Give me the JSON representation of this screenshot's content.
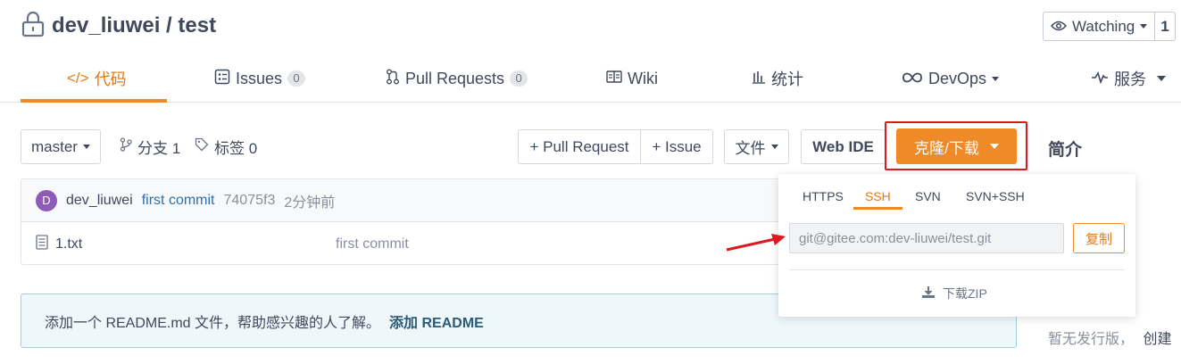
{
  "header": {
    "repo_path": "dev_liuwei / test",
    "watch_label": "Watching",
    "watch_count": "1"
  },
  "tabs": [
    {
      "label": "代码",
      "icon": "code-icon",
      "active": true
    },
    {
      "label": "Issues",
      "icon": "issues-icon",
      "badge": "0"
    },
    {
      "label": "Pull Requests",
      "icon": "pull-request-icon",
      "badge": "0"
    },
    {
      "label": "Wiki",
      "icon": "wiki-icon"
    },
    {
      "label": "统计",
      "icon": "stats-icon"
    },
    {
      "label": "DevOps",
      "icon": "devops-icon"
    },
    {
      "label": "服务",
      "icon": "service-icon"
    }
  ],
  "toolbar": {
    "branch": "master",
    "branch_count_label": "分支 1",
    "tag_count_label": "标签 0",
    "pull_request_label": "+ Pull Request",
    "issue_label": "+ Issue",
    "file_label": "文件",
    "web_ide_label": "Web IDE",
    "clone_label": "克隆/下载"
  },
  "sidebar": {
    "intro_title": "简介",
    "release_text": "暂无发行版，",
    "release_create": "创建"
  },
  "commit": {
    "avatar_letter": "D",
    "author": "dev_liuwei",
    "message": "first commit",
    "hash": "74075f3",
    "time": "2分钟前"
  },
  "files": [
    {
      "name": "1.txt",
      "commit_message": "first commit"
    }
  ],
  "readme_banner": {
    "text": "添加一个 README.md 文件，帮助感兴趣的人了解。",
    "link": "添加 README"
  },
  "clone_dropdown": {
    "protocols": [
      "HTTPS",
      "SSH",
      "SVN",
      "SVN+SSH"
    ],
    "active_protocol": "SSH",
    "url": "git@gitee.com:dev-liuwei/test.git",
    "copy_label": "复制",
    "zip_label": "下载ZIP"
  },
  "colors": {
    "accent": "#ee8a28",
    "highlight_box": "#e0181e",
    "arrow": "#e0181e"
  }
}
